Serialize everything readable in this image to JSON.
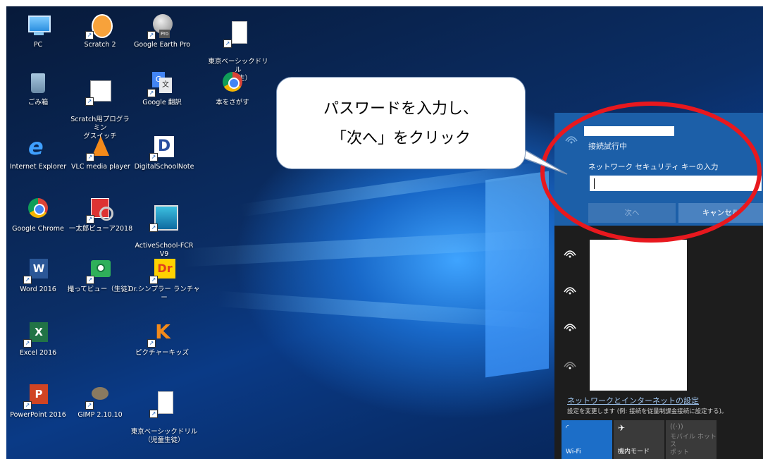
{
  "desktop_icons": [
    {
      "label": "PC",
      "icon": "pc-icon"
    },
    {
      "label": "Scratch 2",
      "icon": "scratch-icon"
    },
    {
      "label": "Google Earth Pro",
      "icon": "google-earth-icon"
    },
    {
      "label": "東京ベーシックドリル\n（先生）",
      "icon": "document-icon"
    },
    {
      "label": "ごみ箱",
      "icon": "recycle-bin-icon"
    },
    {
      "label": "Scratch用プログラミン\nグスイッチ",
      "icon": "program-switch-icon"
    },
    {
      "label": "Google 翻訳",
      "icon": "google-translate-icon"
    },
    {
      "label": "本をさがす",
      "icon": "chrome-icon"
    },
    {
      "label": "Internet Explorer",
      "icon": "internet-explorer-icon"
    },
    {
      "label": "VLC media player",
      "icon": "vlc-icon"
    },
    {
      "label": "DigitalSchoolNote",
      "icon": "digitalschoolnote-icon"
    },
    {
      "label": "Google Chrome",
      "icon": "chrome-icon"
    },
    {
      "label": "一太郎ビューア2018",
      "icon": "ichitaro-viewer-icon"
    },
    {
      "label": "ActiveSchool-FCR\nV9",
      "icon": "activeschool-icon"
    },
    {
      "label": "Word 2016",
      "icon": "word-icon"
    },
    {
      "label": "撮ってビュー（生徒）",
      "icon": "camera-icon"
    },
    {
      "label": "Dr.シンプラー ランチャー",
      "icon": "dr-simpler-icon"
    },
    {
      "label": "Excel 2016",
      "icon": "excel-icon"
    },
    {
      "label": "ピクチャーキッズ",
      "icon": "picture-kids-icon"
    },
    {
      "label": "PowerPoint 2016",
      "icon": "powerpoint-icon"
    },
    {
      "label": "GIMP 2.10.10",
      "icon": "gimp-icon"
    },
    {
      "label": "東京ベーシックドリル\n（児童生徒）",
      "icon": "document-icon"
    }
  ],
  "callout": {
    "line1": "パスワードを入力し、",
    "line2": "「次へ」をクリック"
  },
  "network_flyout": {
    "status": "接続試行中",
    "prompt": "ネットワーク セキュリティ キーの入力",
    "password_value": "",
    "next_button": "次へ",
    "cancel_button": "キャンセル",
    "settings_link": "ネットワークとインターネットの設定",
    "settings_desc": "設定を変更します (例: 接続を従量制課金接続に設定する)。",
    "quick_actions": [
      {
        "label": "Wi-Fi",
        "icon": "wifi-icon",
        "active": true
      },
      {
        "label": "機内モード",
        "icon": "airplane-icon",
        "active": false
      },
      {
        "label": "モバイル ホットス\nポット",
        "icon": "hotspot-icon",
        "active": false
      }
    ]
  },
  "colors": {
    "accent": "#1c5fa8",
    "annotation_ring": "#e8181e",
    "panel_bg": "#1d1d1d"
  }
}
